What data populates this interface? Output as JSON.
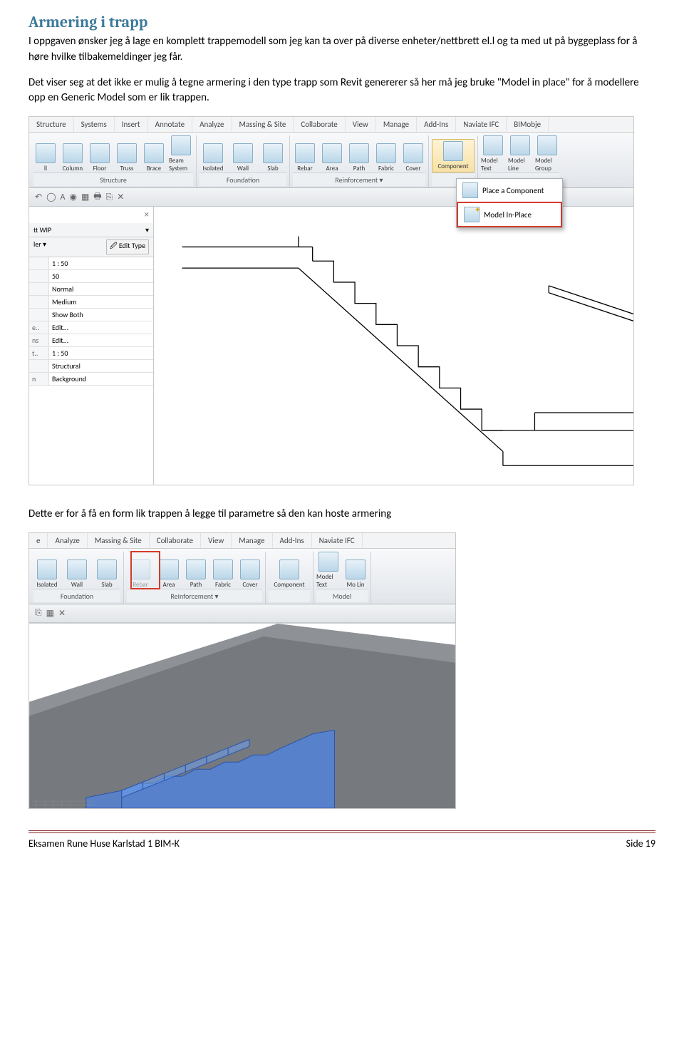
{
  "title": "Armering i trapp",
  "para1": "I oppgaven ønsker jeg å lage en komplett trappemodell som jeg kan ta over på diverse enheter/nettbrett el.l og ta med ut på byggeplass for å høre hvilke tilbakemeldinger jeg får.",
  "para2": "Det viser seg at det ikke er mulig å tegne armering i den type trapp som Revit genererer så her må jeg bruke \"Model in place\" for å modellere opp en Generic Model som er lik trappen.",
  "para3": "Dette er for å få en form lik trappen å legge til parametre så den kan hoste armering",
  "ribbon1": {
    "tabs": [
      "Structure",
      "Systems",
      "Insert",
      "Annotate",
      "Analyze",
      "Massing & Site",
      "Collaborate",
      "View",
      "Manage",
      "Add-Ins",
      "Naviate IFC",
      "BIMobje"
    ],
    "structure": [
      "ll",
      "Column",
      "Floor",
      "Truss",
      "Brace",
      "Beam System"
    ],
    "structure_label": "Structure",
    "foundation": [
      "Isolated",
      "Wall",
      "Slab"
    ],
    "foundation_label": "Foundation",
    "reinforcement": [
      "Rebar",
      "Area",
      "Path",
      "Fabric",
      "Cover"
    ],
    "reinforcement_label": "Reinforcement ▾",
    "component_label": "Component",
    "model": [
      "Model Text",
      "Model Line",
      "Model Group"
    ],
    "drop_place": "Place a Component",
    "drop_inplace": "Model In-Place"
  },
  "props": {
    "header": "tt WIP",
    "edit_type": "Edit Type",
    "rows": [
      {
        "k": "",
        "v": "1 : 50"
      },
      {
        "k": "",
        "v": "50"
      },
      {
        "k": "",
        "v": "Normal"
      },
      {
        "k": "",
        "v": "Medium"
      },
      {
        "k": "",
        "v": "Show Both"
      },
      {
        "k": "e..",
        "v": "Edit..."
      },
      {
        "k": "ns",
        "v": "Edit..."
      },
      {
        "k": "t..",
        "v": "1 : 50"
      },
      {
        "k": "",
        "v": "Structural"
      },
      {
        "k": "n",
        "v": "Background"
      }
    ]
  },
  "ribbon2": {
    "tabs": [
      "e",
      "Analyze",
      "Massing & Site",
      "Collaborate",
      "View",
      "Manage",
      "Add-Ins",
      "Naviate IFC"
    ],
    "foundation": [
      "Isolated",
      "Wall",
      "Slab"
    ],
    "foundation_label": "Foundation",
    "rebar": "Rebar",
    "reinforcement": [
      "Area",
      "Path",
      "Fabric",
      "Cover"
    ],
    "reinforcement_label": "Reinforcement ▾",
    "component": "Component",
    "model": [
      "Model Text",
      "Mo Lin"
    ],
    "model_label": "Model"
  },
  "footer": {
    "left": "Eksamen Rune Huse Karlstad 1 BIM-K",
    "right": "Side 19"
  }
}
